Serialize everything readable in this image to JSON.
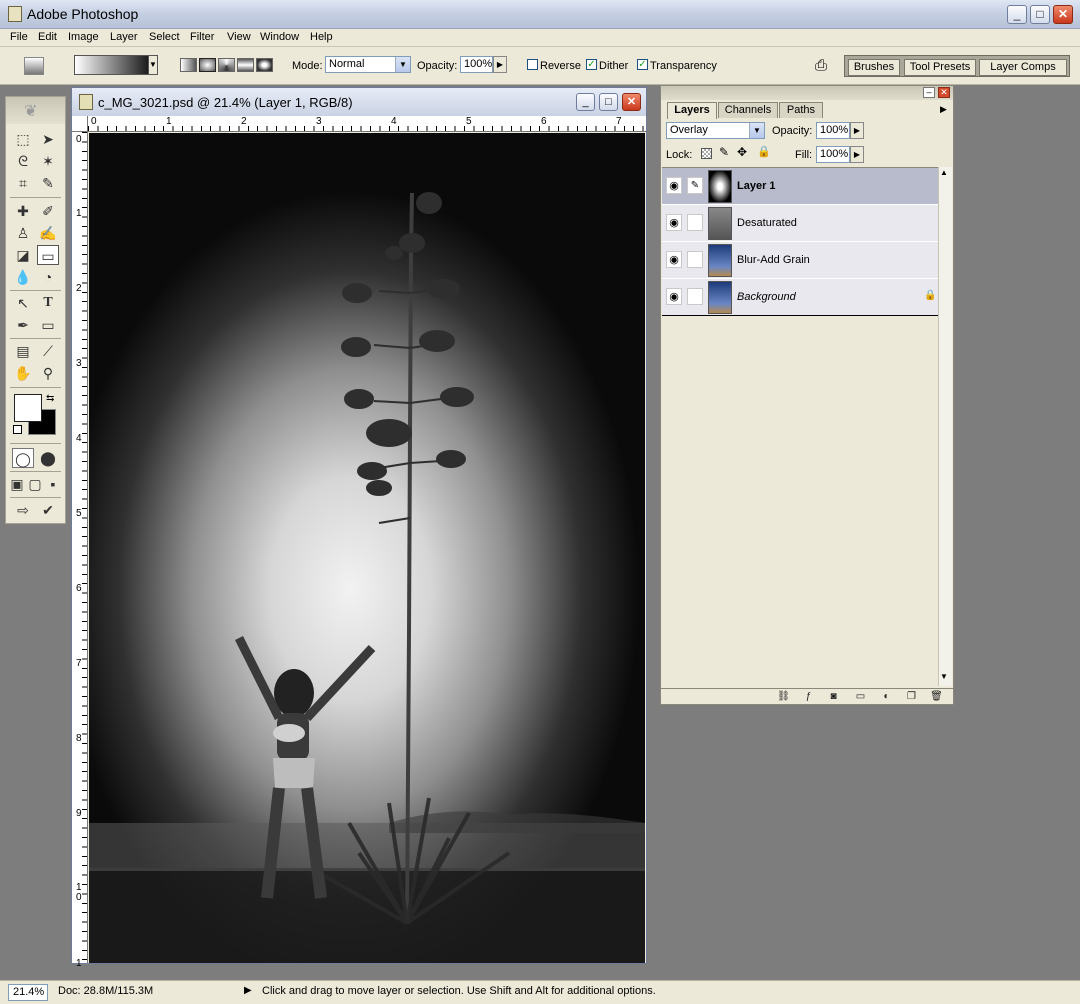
{
  "app": {
    "title": "Adobe Photoshop",
    "window_buttons": {
      "minimize": "_",
      "maximize": "□",
      "close": "✕"
    }
  },
  "menu": {
    "items": [
      "File",
      "Edit",
      "Image",
      "Layer",
      "Select",
      "Filter",
      "View",
      "Window",
      "Help"
    ]
  },
  "options": {
    "mode_label": "Mode:",
    "mode_value": "Normal",
    "opacity_label": "Opacity:",
    "opacity_value": "100%",
    "reverse_label": "Reverse",
    "reverse_checked": false,
    "dither_label": "Dither",
    "dither_checked": true,
    "transparency_label": "Transparency",
    "transparency_checked": true
  },
  "palette_well": {
    "tabs": [
      "Brushes",
      "Tool Presets",
      "Layer Comps"
    ]
  },
  "document": {
    "title": "c_MG_3021.psd @ 21.4% (Layer 1, RGB/8)",
    "ruler_h": [
      "0",
      "1",
      "2",
      "3",
      "4",
      "5",
      "6",
      "7"
    ],
    "ruler_v": [
      "0",
      "1",
      "2",
      "3",
      "4",
      "5",
      "6",
      "7",
      "8",
      "9",
      "1 0",
      "1"
    ]
  },
  "layers_panel": {
    "tabs": [
      "Layers",
      "Channels",
      "Paths"
    ],
    "active_tab": "Layers",
    "blend_mode": "Overlay",
    "opacity_label": "Opacity:",
    "opacity_value": "100%",
    "lock_label": "Lock:",
    "fill_label": "Fill:",
    "fill_value": "100%",
    "layers": [
      {
        "name": "Layer 1",
        "selected": true,
        "visible": true
      },
      {
        "name": "Desaturated",
        "selected": false,
        "visible": true
      },
      {
        "name": "Blur-Add Grain",
        "selected": false,
        "visible": true
      },
      {
        "name": "Background",
        "selected": false,
        "visible": true,
        "locked": true
      }
    ]
  },
  "status": {
    "zoom": "21.4%",
    "doc_size": "Doc: 28.8M/115.3M",
    "message": "Click and drag to move layer or selection.  Use Shift and Alt for additional options."
  },
  "colors": {
    "foreground": "#ffffff",
    "background": "#000000",
    "workspace": "#7d7d7d",
    "selected_layer": "#b8bbcc"
  },
  "icons": {
    "tools": [
      "marquee-icon",
      "move-icon",
      "lasso-icon",
      "magic-wand-icon",
      "crop-icon",
      "slice-icon",
      "healing-brush-icon",
      "brush-icon",
      "clone-stamp-icon",
      "history-brush-icon",
      "eraser-icon",
      "gradient-icon",
      "blur-icon",
      "dodge-icon",
      "path-selection-icon",
      "type-icon",
      "pen-icon",
      "rectangle-icon",
      "notes-icon",
      "eyedropper-icon",
      "hand-icon",
      "zoom-icon"
    ]
  }
}
